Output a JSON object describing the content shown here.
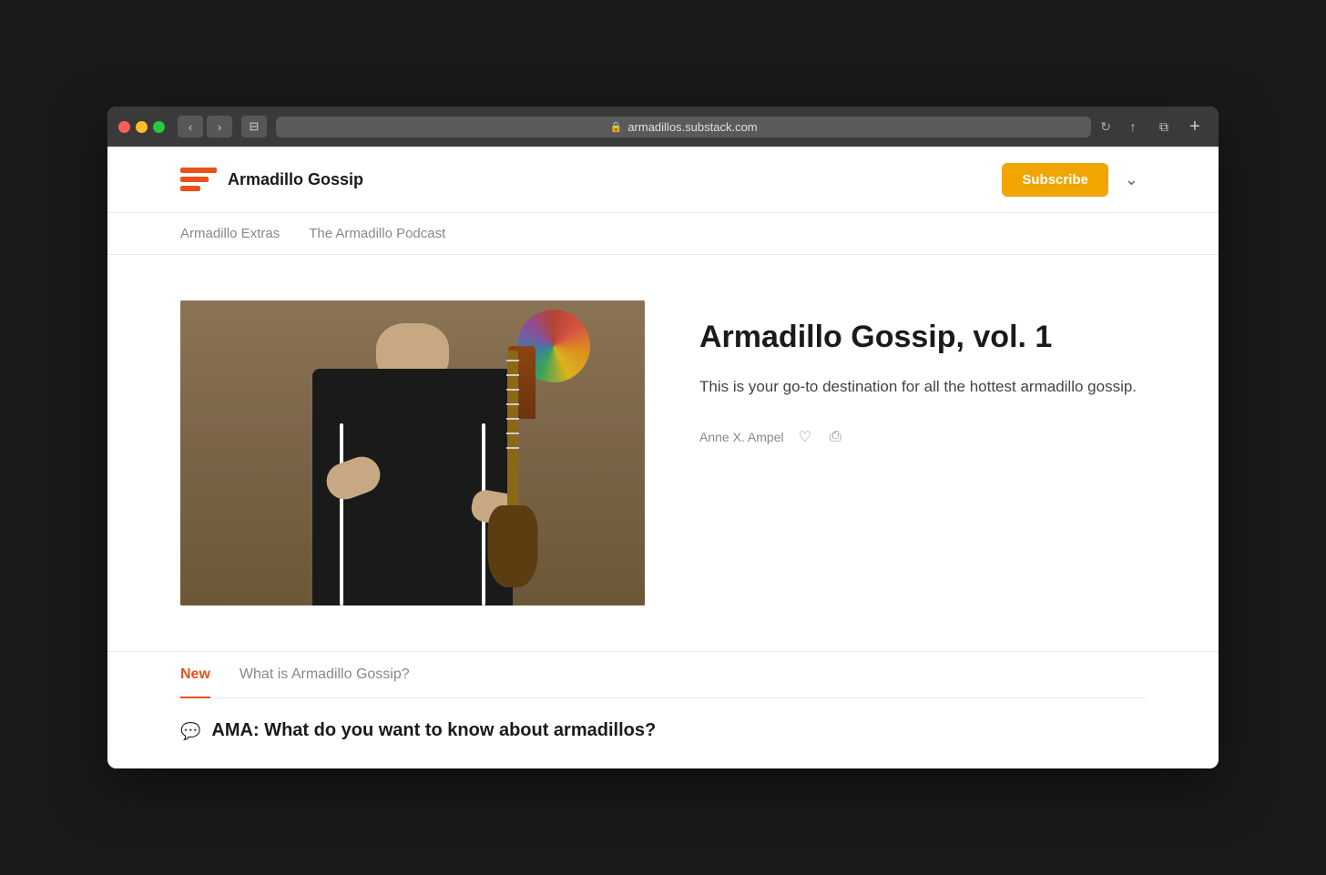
{
  "browser": {
    "url": "armadillos.substack.com",
    "back_label": "‹",
    "forward_label": "›",
    "sidebar_label": "⊟",
    "reload_label": "↻",
    "share_label": "↑",
    "tabs_label": "⧉",
    "new_tab_label": "+"
  },
  "header": {
    "brand_name": "Armadillo Gossip",
    "subscribe_label": "Subscribe",
    "chevron_label": "⌄"
  },
  "nav": {
    "items": [
      {
        "id": "armadillo-extras",
        "label": "Armadillo Extras"
      },
      {
        "id": "armadillo-podcast",
        "label": "The Armadillo Podcast"
      }
    ]
  },
  "hero": {
    "title": "Armadillo Gossip, vol. 1",
    "description": "This is your go-to destination for all the hottest armadillo gossip.",
    "author": "Anne X. Ampel",
    "like_icon": "♡",
    "share_icon": "⎙"
  },
  "tabs": {
    "items": [
      {
        "id": "new",
        "label": "New",
        "active": true
      },
      {
        "id": "what-is",
        "label": "What is Armadillo Gossip?",
        "active": false
      }
    ]
  },
  "post": {
    "icon": "💬",
    "title": "AMA: What do you want to know about armadillos?"
  }
}
